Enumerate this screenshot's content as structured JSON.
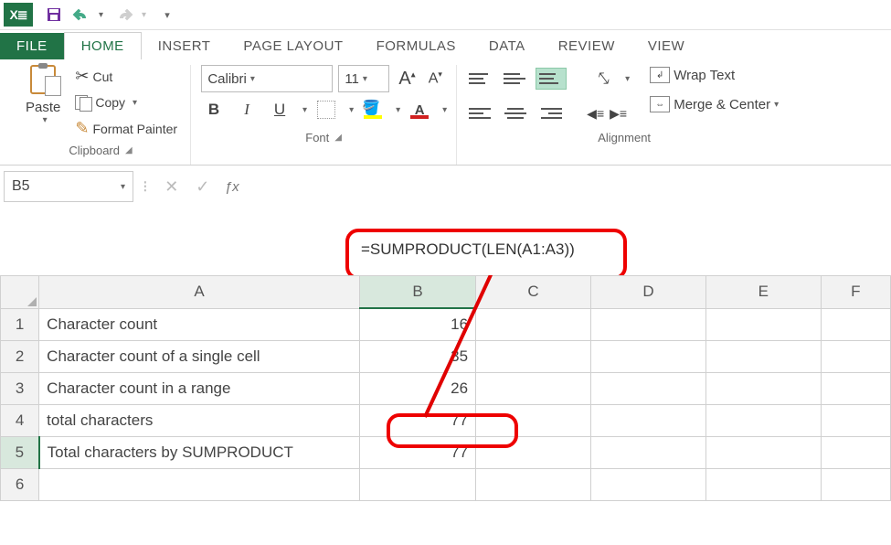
{
  "qat": {
    "undo_tip": "Undo",
    "redo_tip": "Redo"
  },
  "tabs": {
    "file": "FILE",
    "home": "HOME",
    "insert": "INSERT",
    "page_layout": "PAGE LAYOUT",
    "formulas": "FORMULAS",
    "data": "DATA",
    "review": "REVIEW",
    "view": "VIEW"
  },
  "ribbon": {
    "clipboard": {
      "label": "Clipboard",
      "paste": "Paste",
      "cut": "Cut",
      "copy": "Copy",
      "format_painter": "Format Painter"
    },
    "font": {
      "label": "Font",
      "name": "Calibri",
      "size": "11"
    },
    "alignment": {
      "label": "Alignment",
      "wrap": "Wrap Text",
      "merge": "Merge & Center"
    }
  },
  "name_box": "B5",
  "formula": "=SUMPRODUCT(LEN(A1:A3))",
  "columns": [
    "A",
    "B",
    "C",
    "D",
    "E",
    "F"
  ],
  "rows": [
    {
      "n": "1",
      "a": "Character count",
      "b": "16"
    },
    {
      "n": "2",
      "a": "Character count of a single cell",
      "b": "35"
    },
    {
      "n": "3",
      "a": "Character count in a range",
      "b": "26"
    },
    {
      "n": "4",
      "a": "total characters",
      "b": "77"
    },
    {
      "n": "5",
      "a": "Total characters by SUMPRODUCT",
      "b": "77"
    },
    {
      "n": "6",
      "a": "",
      "b": ""
    }
  ],
  "selected_cell_row": 5,
  "chart_data": {
    "type": "table",
    "columns": [
      "A",
      "B"
    ],
    "rows": [
      [
        "Character count",
        16
      ],
      [
        "Character count of a single cell",
        35
      ],
      [
        "Character count in a range",
        26
      ],
      [
        "total characters",
        77
      ],
      [
        "Total characters by SUMPRODUCT",
        77
      ]
    ],
    "formula_in_B5": "=SUMPRODUCT(LEN(A1:A3))"
  },
  "annotation": {
    "highlight_color": "#e00000",
    "arrow_from": "cell B5",
    "arrow_to": "formula bar"
  }
}
